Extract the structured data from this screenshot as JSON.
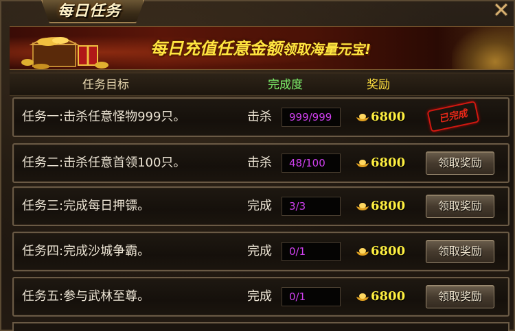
{
  "window": {
    "title": "每日任务",
    "close_icon": "close-x-icon"
  },
  "banner": {
    "text_main": "每日充值任意金额",
    "text_tail": "领取海量元宝!"
  },
  "header": {
    "goal": "任务目标",
    "progress": "完成度",
    "reward": "奖励"
  },
  "tasks": [
    {
      "name": "任务一:击杀任意怪物999只。",
      "verb": "击杀",
      "progress": "999/999",
      "reward": "6800",
      "status": "已完成",
      "claim_label": ""
    },
    {
      "name": "任务二:击杀任意首领100只。",
      "verb": "击杀",
      "progress": "48/100",
      "reward": "6800",
      "status": "",
      "claim_label": "领取奖励"
    },
    {
      "name": "任务三:完成每日押镖。",
      "verb": "完成",
      "progress": "3/3",
      "reward": "6800",
      "status": "",
      "claim_label": "领取奖励"
    },
    {
      "name": "任务四:完成沙城争霸。",
      "verb": "完成",
      "progress": "0/1",
      "reward": "6800",
      "status": "",
      "claim_label": "领取奖励"
    },
    {
      "name": "任务五:参与武林至尊。",
      "verb": "完成",
      "progress": "0/1",
      "reward": "6800",
      "status": "",
      "claim_label": "领取奖励"
    }
  ],
  "colors": {
    "header_progress": "#7cf06a",
    "header_reward": "#ffe040",
    "progress_text": "#d040f0",
    "reward_text": "#fff040",
    "stamp_red": "#e82818"
  }
}
